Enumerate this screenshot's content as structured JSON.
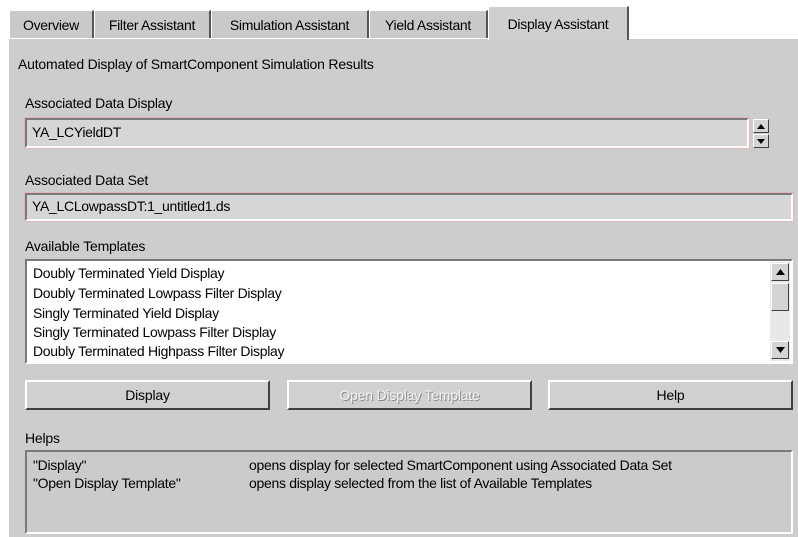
{
  "tabs": [
    {
      "label": "Overview"
    },
    {
      "label": "Filter Assistant"
    },
    {
      "label": "Simulation Assistant"
    },
    {
      "label": "Yield Assistant"
    },
    {
      "label": "Display Assistant"
    }
  ],
  "active_tab": "Display Assistant",
  "panel": {
    "description": "Automated Display of SmartComponent Simulation Results",
    "associated_data_display": {
      "label": "Associated Data Display",
      "value": "YA_LCYieldDT"
    },
    "associated_data_set": {
      "label": "Associated Data Set",
      "value": "YA_LCLowpassDT:1_untitled1.ds"
    },
    "available_templates": {
      "label": "Available Templates",
      "items": [
        "Doubly Terminated Yield Display",
        "Doubly Terminated Lowpass Filter Display",
        "Singly Terminated Yield Display",
        "Singly Terminated Lowpass Filter Display",
        "Doubly Terminated Highpass Filter Display"
      ]
    },
    "buttons": {
      "display": "Display",
      "open_template": "Open Display Template",
      "help": "Help"
    },
    "helps": {
      "label": "Helps",
      "rows": [
        {
          "key": "\"Display\"",
          "text": "opens display for selected SmartComponent using Associated Data Set"
        },
        {
          "key": "\"Open Display Template\"",
          "text": "opens display selected from the list of Available Templates"
        }
      ]
    }
  },
  "icons": {
    "spin_up": "arrow-up-icon",
    "spin_down": "arrow-down-icon",
    "scroll_up": "arrow-up-icon",
    "scroll_down": "arrow-down-icon"
  },
  "colors": {
    "panel_bg": "#cdcdcd",
    "list_bg": "#ffffff",
    "field_bg": "#d6d6d6"
  }
}
